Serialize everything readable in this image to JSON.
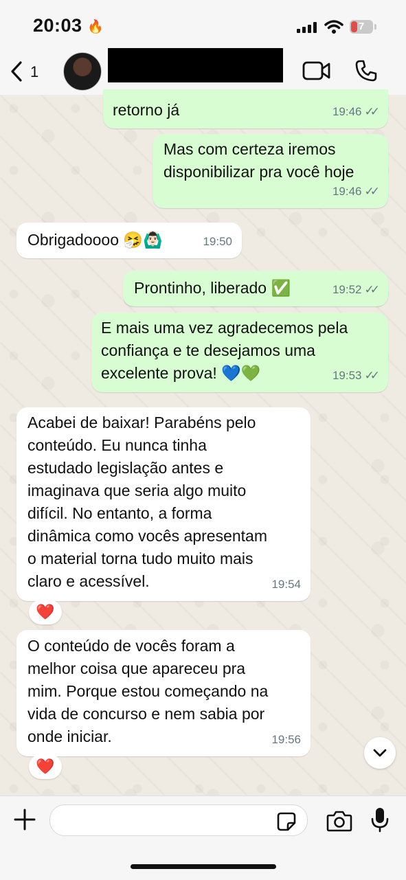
{
  "status_bar": {
    "time": "20:03",
    "battery": "7"
  },
  "header": {
    "back_count": "1"
  },
  "messages": [
    {
      "text": "retorno já",
      "time": "19:46"
    },
    {
      "text": "Mas com certeza iremos\ndisponibilizar pra você hoje",
      "time": "19:46"
    },
    {
      "text": "Obrigadoooo 🤧🙆🏻‍♂️",
      "time": "19:50"
    },
    {
      "text": "Prontinho, liberado ✅",
      "time": "19:52"
    },
    {
      "text": "E mais uma vez agradecemos pela\nconfiança e te desejamos uma\nexcelente prova! 💙💚",
      "time": "19:53"
    },
    {
      "text": "Acabei de baixar! Parabéns pelo\nconteúdo. Eu nunca tinha\nestudado legislação antes e\nimaginava que seria algo muito\ndifícil. No entanto, a forma\ndinâmica como vocês apresentam\no material torna tudo muito mais\nclaro e acessível.",
      "time": "19:54",
      "reaction": "❤️"
    },
    {
      "text": "O conteúdo de vocês foram a\nmelhor coisa que apareceu pra\nmim. Porque estou começando na\nvida de concurso e nem sabia por\nonde iniciar.",
      "time": "19:56",
      "reaction": "❤️"
    }
  ],
  "ticks": "✓✓",
  "icons": [
    "back-chevron-icon",
    "video-call-icon",
    "phone-icon",
    "plus-icon",
    "sticker-icon",
    "camera-icon",
    "microphone-icon",
    "chevron-down-icon"
  ],
  "colors": {
    "outgoing_bubble": "#d9fdd3",
    "incoming_bubble": "#ffffff",
    "chat_background": "#efeae2",
    "reaction_heart": "#e5251a"
  }
}
